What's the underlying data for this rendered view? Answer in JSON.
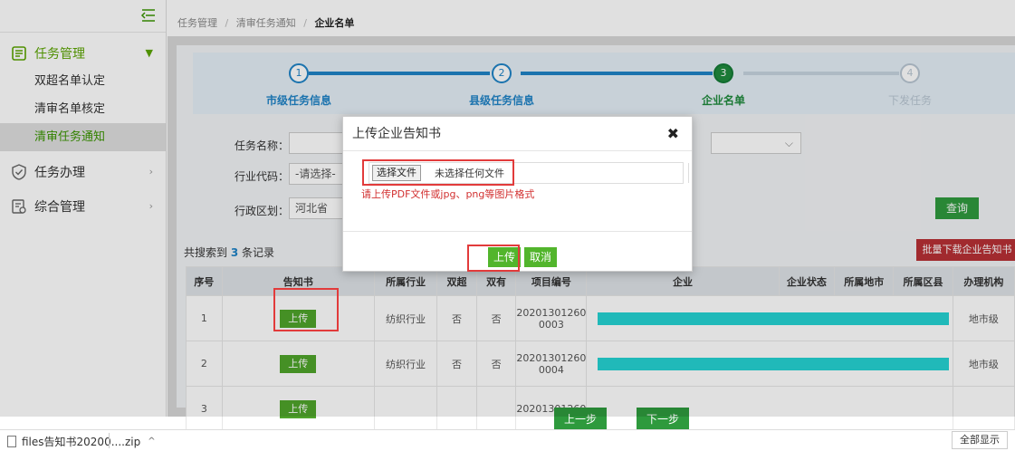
{
  "sidebar": {
    "groups": [
      {
        "label": "任务管理",
        "expanded": true,
        "items": [
          "双超名单认定",
          "清审名单核定",
          "清审任务通知"
        ],
        "active_item": "清审任务通知"
      },
      {
        "label": "任务办理"
      },
      {
        "label": "综合管理"
      }
    ]
  },
  "breadcrumb": {
    "items": [
      "任务管理",
      "清审任务通知"
    ],
    "current": "企业名单",
    "separator": "/"
  },
  "steps": [
    {
      "num": "1",
      "label": "市级任务信息",
      "state": "done"
    },
    {
      "num": "2",
      "label": "县级任务信息",
      "state": "done"
    },
    {
      "num": "3",
      "label": "企业名单",
      "state": "current"
    },
    {
      "num": "4",
      "label": "下发任务",
      "state": "todo"
    }
  ],
  "filters": {
    "task_name_label": "任务名称：",
    "industry_label": "行业代码：",
    "industry_value": "-请选择-",
    "region_label": "行政区划：",
    "region_value": "河北省",
    "query_button": "查询"
  },
  "results": {
    "prefix": "共搜索到",
    "count": "3",
    "suffix": "条记录",
    "batch_button": "批量下载企业告知书"
  },
  "table": {
    "headers": [
      "序号",
      "告知书",
      "所属行业",
      "双超",
      "双有",
      "项目编号",
      "企业",
      "企业状态",
      "所属地市",
      "所属区县",
      "办理机构"
    ],
    "rows": [
      {
        "no": "1",
        "action": "上传",
        "industry": "纺织行业",
        "c1": "否",
        "c2": "否",
        "code_a": "20201301260",
        "code_b": "0003",
        "org": "地市级"
      },
      {
        "no": "2",
        "action": "上传",
        "industry": "纺织行业",
        "c1": "否",
        "c2": "否",
        "code_a": "20201301260",
        "code_b": "0004",
        "org": "地市级"
      },
      {
        "no": "3",
        "action": "上传",
        "industry": "",
        "c1": "",
        "c2": "",
        "code_a": "20201301260",
        "code_b": "",
        "org": ""
      }
    ]
  },
  "bottom": {
    "prev": "上一步",
    "next": "下一步"
  },
  "modal": {
    "title": "上传企业告知书",
    "close": "✖",
    "choose_file": "选择文件",
    "no_file": "未选择任何文件",
    "hint": "请上传PDF文件或jpg、png等图片格式",
    "upload": "上传",
    "cancel": "取消"
  },
  "downloads": {
    "file": "files告知书20200....zip",
    "caret": "^",
    "show_all": "全部显示"
  },
  "colors": {
    "accent_green": "#52b52c",
    "step_blue": "#1f83c7",
    "batch_red": "#b83035",
    "highlight_red": "#e23b3b",
    "redacted_cyan": "#25d3d3"
  }
}
